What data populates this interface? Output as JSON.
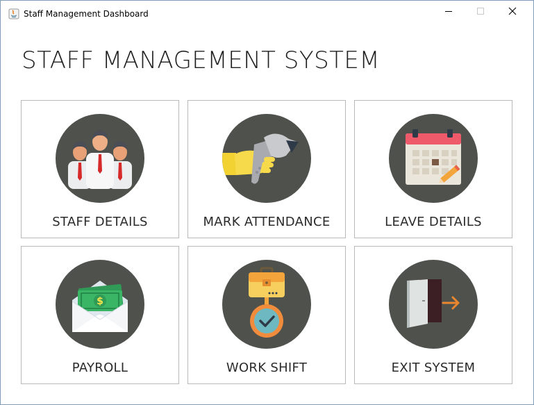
{
  "window": {
    "title": "Staff Management Dashboard",
    "controls": [
      "minimize",
      "maximize",
      "close"
    ]
  },
  "heading": "STAFF MANAGEMENT SYSTEM",
  "tiles": [
    {
      "label": "STAFF DETAILS",
      "icon": "staff-group-icon"
    },
    {
      "label": "MARK ATTENDANCE",
      "icon": "barcode-scanner-icon"
    },
    {
      "label": "LEAVE DETAILS",
      "icon": "calendar-icon"
    },
    {
      "label": "PAYROLL",
      "icon": "money-envelope-icon"
    },
    {
      "label": "WORK SHIFT",
      "icon": "briefcase-clock-icon"
    },
    {
      "label": "EXIT SYSTEM",
      "icon": "exit-door-icon"
    }
  ],
  "colors": {
    "icon_circle": "#4f524c",
    "tile_border": "#b9b9b9",
    "window_border": "#7f9db9"
  }
}
